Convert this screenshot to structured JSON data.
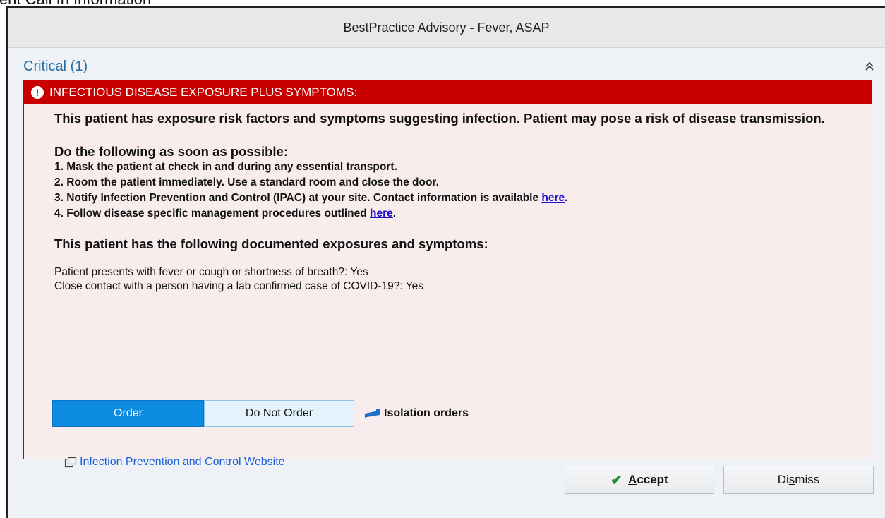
{
  "background": {
    "partial_text": "ient Call In Information"
  },
  "window": {
    "title": "BestPractice Advisory - Fever, ASAP"
  },
  "section": {
    "title": "Critical (1)"
  },
  "alert": {
    "header": "INFECTIOUS DISEASE EXPOSURE PLUS SYMPTOMS:",
    "intro": "This patient has exposure risk factors and symptoms suggesting infection. Patient may pose a risk of disease transmission.",
    "todo_heading": "Do the following as soon as possible:",
    "steps": [
      {
        "text": "1. Mask the patient at check in and during any essential transport."
      },
      {
        "text": "2. Room the patient immediately. Use a standard room and close the door."
      },
      {
        "text": "3. Notify Infection Prevention and Control (IPAC) at your site. Contact information is available ",
        "link": "here",
        "after": "."
      },
      {
        "text": "4. Follow disease specific management procedures outlined ",
        "link": "here",
        "after": "."
      }
    ],
    "exposures_heading": "This patient has the following documented exposures and symptoms:",
    "exposures": [
      "Patient presents with fever or cough or shortness of breath?: Yes",
      "Close contact with a person having a lab confirmed case of COVID-19?: Yes"
    ],
    "order_label": "Order",
    "do_not_order_label": "Do Not Order",
    "isolation_label": "Isolation orders",
    "website_link": "Infection Prevention and Control Website"
  },
  "footer": {
    "accept_prefix": "",
    "accept_underlined": "A",
    "accept_rest": "ccept",
    "dismiss_prefix": "Di",
    "dismiss_underlined": "s",
    "dismiss_rest": "miss"
  },
  "colors": {
    "critical_red": "#c90000",
    "order_blue": "#0d8be0",
    "link_blue": "#1a0dcc",
    "section_blue": "#2b6d9e"
  }
}
